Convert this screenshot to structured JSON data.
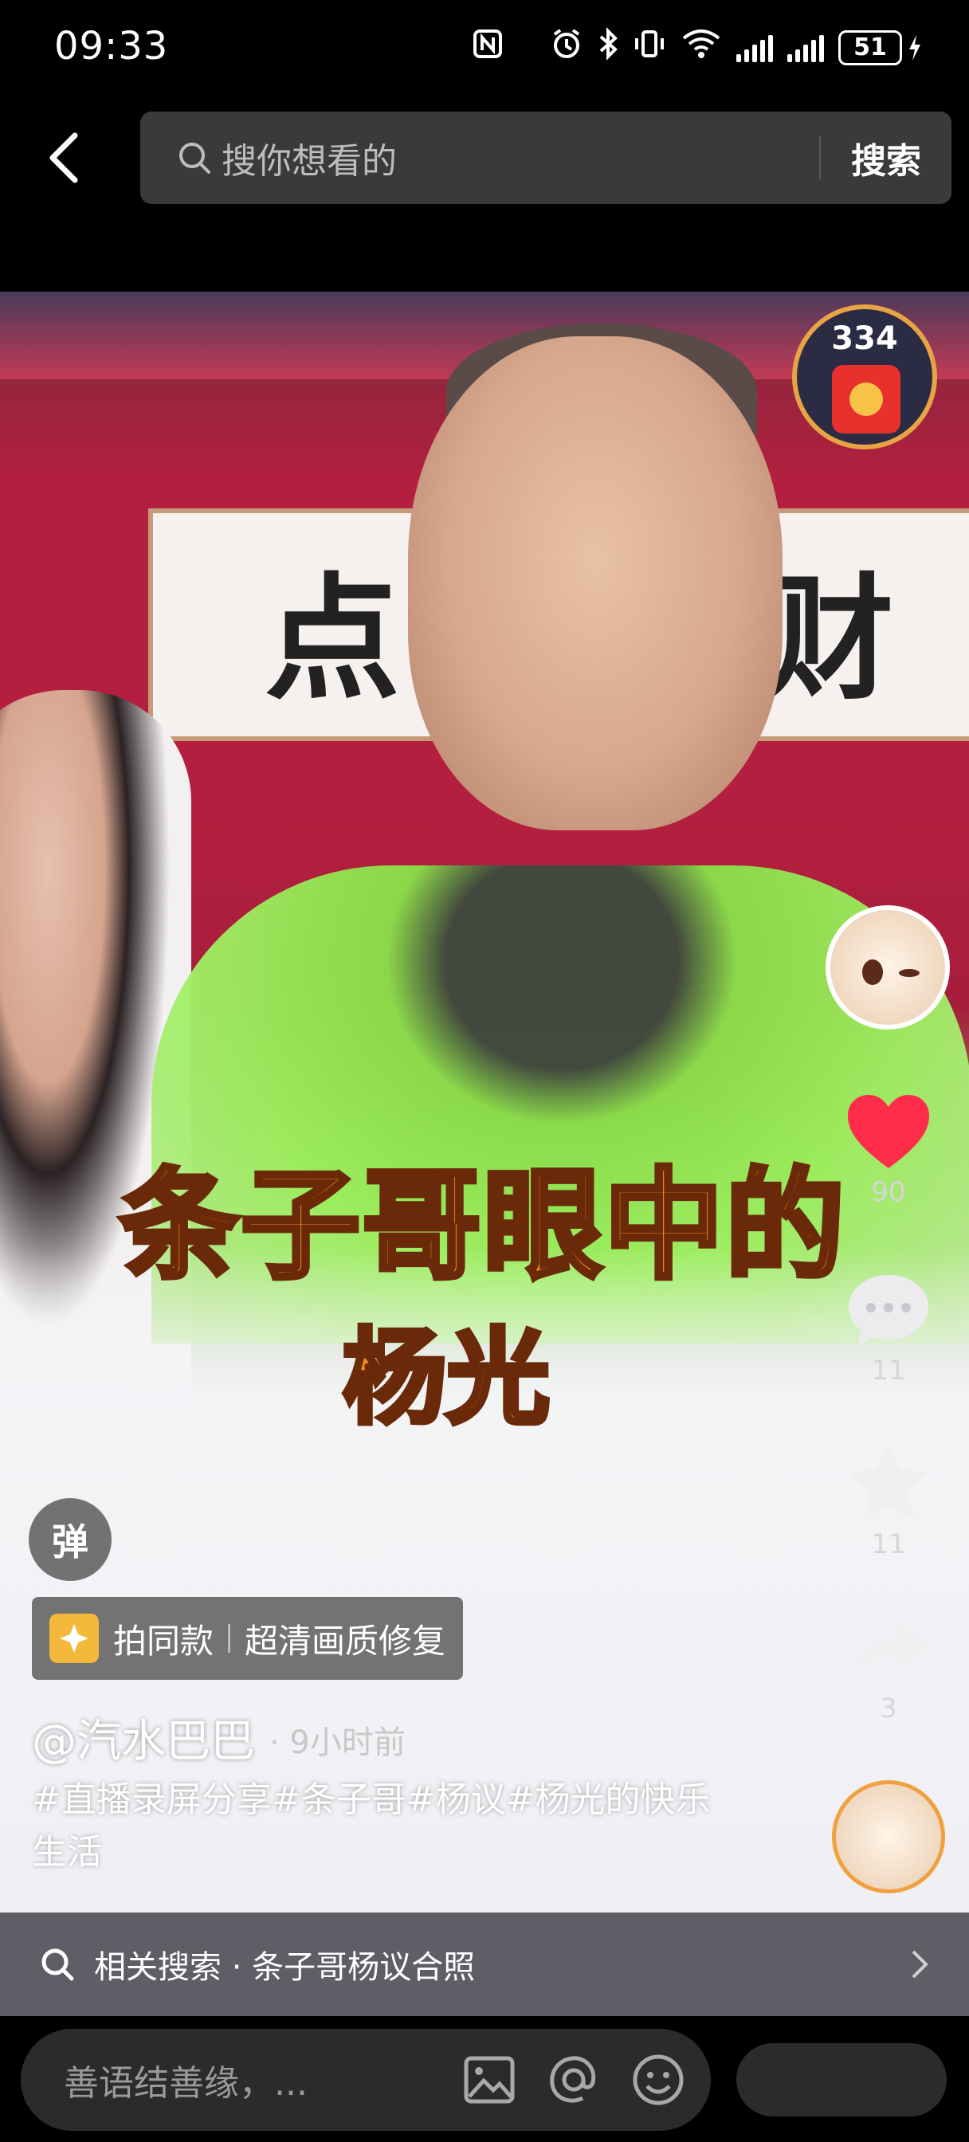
{
  "status_bar": {
    "time": "09:33",
    "battery": "51"
  },
  "header": {
    "search_placeholder": "搜你想看的",
    "search_button": "搜索"
  },
  "video": {
    "sign_char_left": "点",
    "sign_char_right": "财",
    "caption_line1": "条子哥眼中的",
    "caption_line2": "杨光"
  },
  "side": {
    "red_packet_count": "334",
    "like_count": "90",
    "comment_count": "11",
    "favorite_count": "11",
    "share_count": "3"
  },
  "info": {
    "danmu_label": "弹",
    "same_style_label": "拍同款",
    "hd_repair_label": "超清画质修复",
    "author": "@汽水巴巴",
    "time_ago": "· 9小时前",
    "description": "#直播录屏分享#条子哥#杨议#杨光的快乐生活"
  },
  "related": {
    "label": "相关搜索 · 条子哥杨议合照"
  },
  "comment_bar": {
    "placeholder": "善语结善缘，..."
  },
  "colors": {
    "like": "#ff2d4a",
    "caption": "#f28a1c",
    "gold": "#f2b93b"
  }
}
